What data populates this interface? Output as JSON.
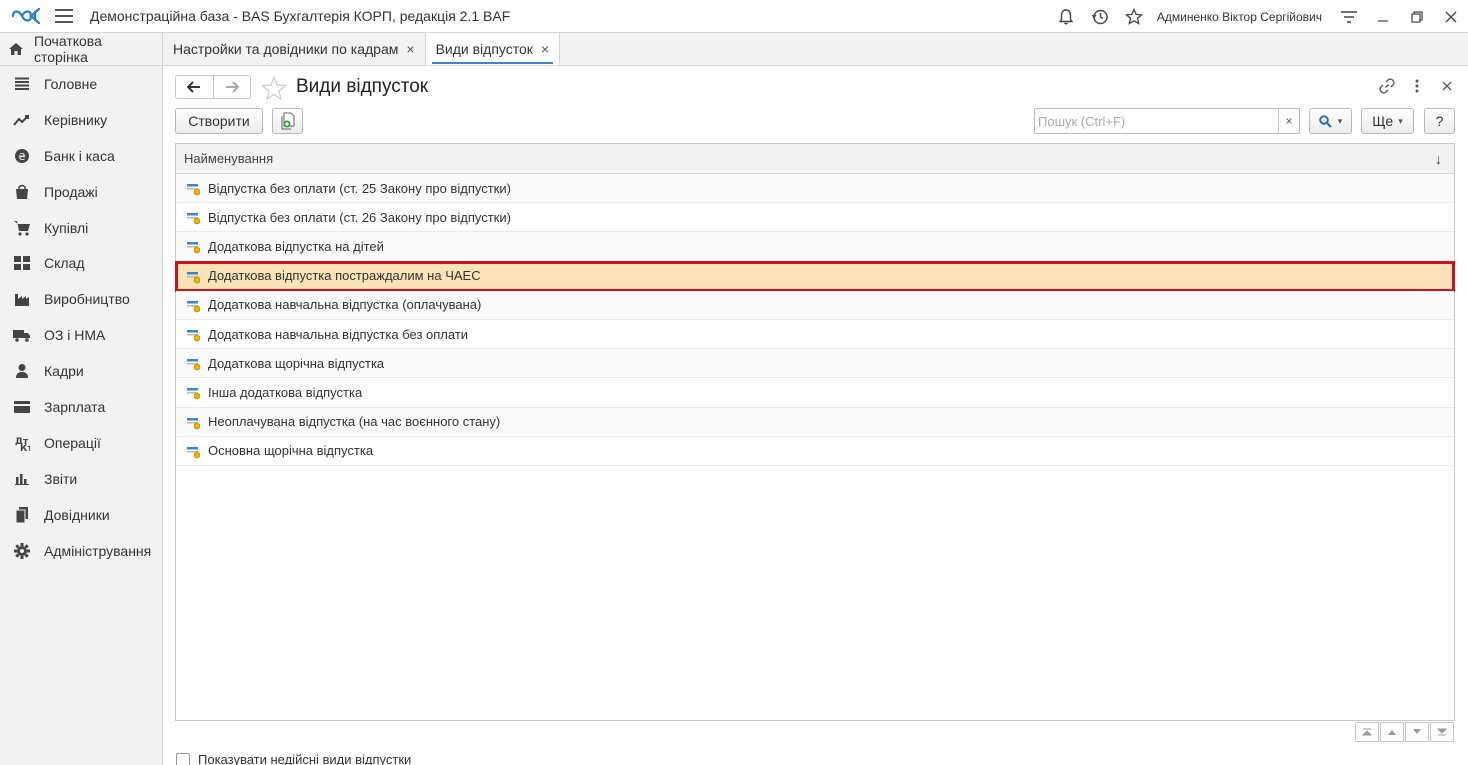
{
  "app": {
    "title": "Демонстраційна база - BAS Бухгалтерія КОРП, редакція 2.1 BAF",
    "user": "Админенко Віктор Сергійович"
  },
  "tabs": [
    {
      "label": "Початкова сторінка",
      "icon": "home-icon"
    },
    {
      "label": "Настройки та довідники по кадрам",
      "close": "×"
    },
    {
      "label": "Види відпусток",
      "close": "×",
      "active": true
    }
  ],
  "sidebar": {
    "items": [
      {
        "label": "Головне",
        "icon": "list-icon"
      },
      {
        "label": "Керівнику",
        "icon": "trend-icon"
      },
      {
        "label": "Банк і каса",
        "icon": "coin-icon"
      },
      {
        "label": "Продажі",
        "icon": "bag-icon"
      },
      {
        "label": "Купівлі",
        "icon": "cart-icon"
      },
      {
        "label": "Склад",
        "icon": "grid-icon"
      },
      {
        "label": "Виробництво",
        "icon": "factory-icon"
      },
      {
        "label": "ОЗ і НМА",
        "icon": "truck-icon"
      },
      {
        "label": "Кадри",
        "icon": "person-icon"
      },
      {
        "label": "Зарплата",
        "icon": "wallet-icon"
      },
      {
        "label": "Операції",
        "icon": "operations-icon"
      },
      {
        "label": "Звіти",
        "icon": "bar-chart-icon"
      },
      {
        "label": "Довідники",
        "icon": "books-icon"
      },
      {
        "label": "Адміністрування",
        "icon": "gear-icon"
      }
    ]
  },
  "main": {
    "title": "Види відпусток",
    "create_label": "Створити",
    "search_placeholder": "Пошук (Ctrl+F)",
    "search_clear": "×",
    "more_label": "Ще",
    "more_arrow": "▾",
    "search_arrow": "▾",
    "help_label": "?",
    "column_header": "Найменування",
    "sort_indicator": "↓",
    "rows": [
      {
        "name": "Відпустка без оплати (ст. 25 Закону про відпустки)"
      },
      {
        "name": "Відпустка без оплати (ст. 26 Закону про відпустки)"
      },
      {
        "name": "Додаткова відпустка на дітей"
      },
      {
        "name": "Додаткова відпустка постраждалим на ЧАЕС",
        "selected": true
      },
      {
        "name": "Додаткова навчальна відпустка (оплачувана)"
      },
      {
        "name": "Додаткова навчальна відпустка без оплати"
      },
      {
        "name": "Додаткова щорічна відпустка"
      },
      {
        "name": "Інша додаткова відпустка"
      },
      {
        "name": "Неоплачувана відпустка (на час воєнного стану)"
      },
      {
        "name": "Основна щорічна відпустка"
      }
    ],
    "show_invalid_label": "Показувати недійсні види відпустки"
  },
  "colors": {
    "accent": "#3a84c9",
    "selected_row": "#fbe3b8",
    "highlight_border": "#d0101a"
  }
}
